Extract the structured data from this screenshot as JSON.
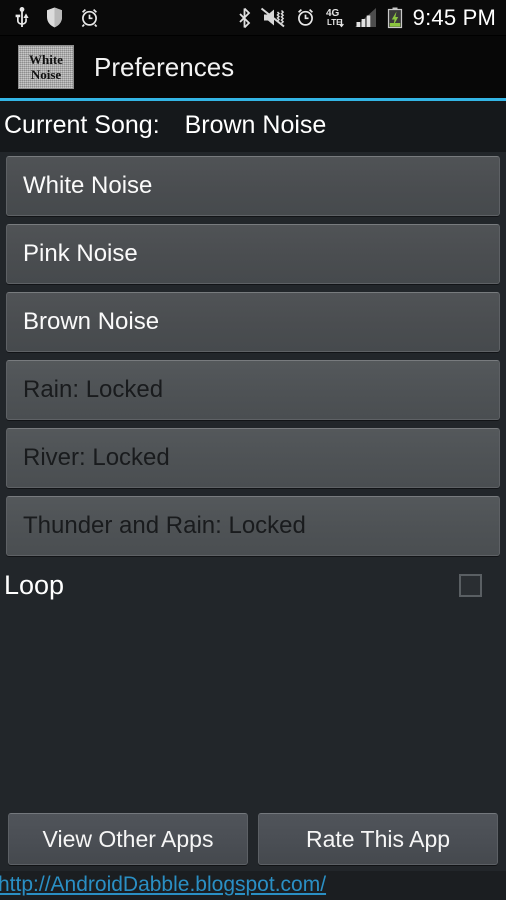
{
  "status_bar": {
    "icons_left": [
      "usb-icon",
      "shield-icon",
      "alarm-clock-icon"
    ],
    "icons_right": [
      "bluetooth-icon",
      "vibrate-mute-icon",
      "alarm-clock-icon",
      "4g-lte-icon",
      "signal-bars-icon",
      "battery-charging-icon"
    ],
    "clock": "9:45 PM",
    "lte_top": "4G",
    "lte_bottom": "LTE"
  },
  "title_bar": {
    "app_icon_line1": "White",
    "app_icon_line2": "Noise",
    "title": "Preferences",
    "accent_color": "#33b5e5"
  },
  "current_song": {
    "label": "Current Song:",
    "value": "Brown Noise"
  },
  "songs": [
    {
      "label": "White Noise",
      "locked": false
    },
    {
      "label": "Pink Noise",
      "locked": false
    },
    {
      "label": "Brown Noise",
      "locked": false
    },
    {
      "label": "Rain: Locked",
      "locked": true
    },
    {
      "label": "River: Locked",
      "locked": true
    },
    {
      "label": "Thunder and Rain: Locked",
      "locked": true
    }
  ],
  "loop": {
    "label": "Loop",
    "checked": false
  },
  "footer": {
    "view_other_apps": "View Other Apps",
    "rate_this_app": "Rate This App",
    "link": "http://AndroidDabble.blogspot.com/",
    "link_color": "#2a8fc4"
  }
}
